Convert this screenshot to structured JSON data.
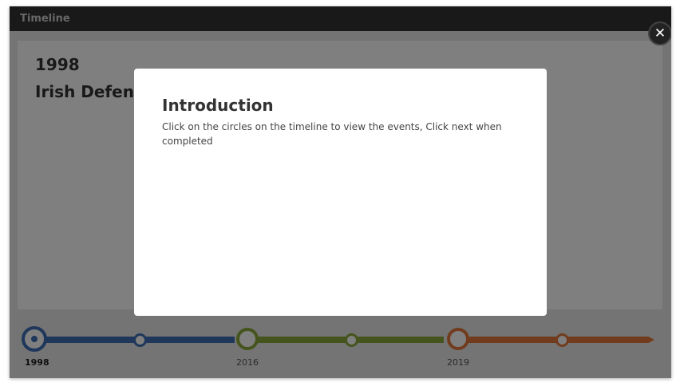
{
  "window": {
    "title": "Timeline"
  },
  "event": {
    "year": "1998",
    "title": "Irish Defence"
  },
  "timeline": {
    "labels": [
      "1998",
      "2016",
      "2019"
    ],
    "colors": {
      "blue": "#3d6fb6",
      "green": "#8aa83a",
      "orange": "#e3783c"
    }
  },
  "modal": {
    "title": "Introduction",
    "body": "Click on the circles on the timeline to view the events, Click next when completed"
  },
  "close_button": {
    "icon": "close-icon",
    "glyph": "✕"
  }
}
